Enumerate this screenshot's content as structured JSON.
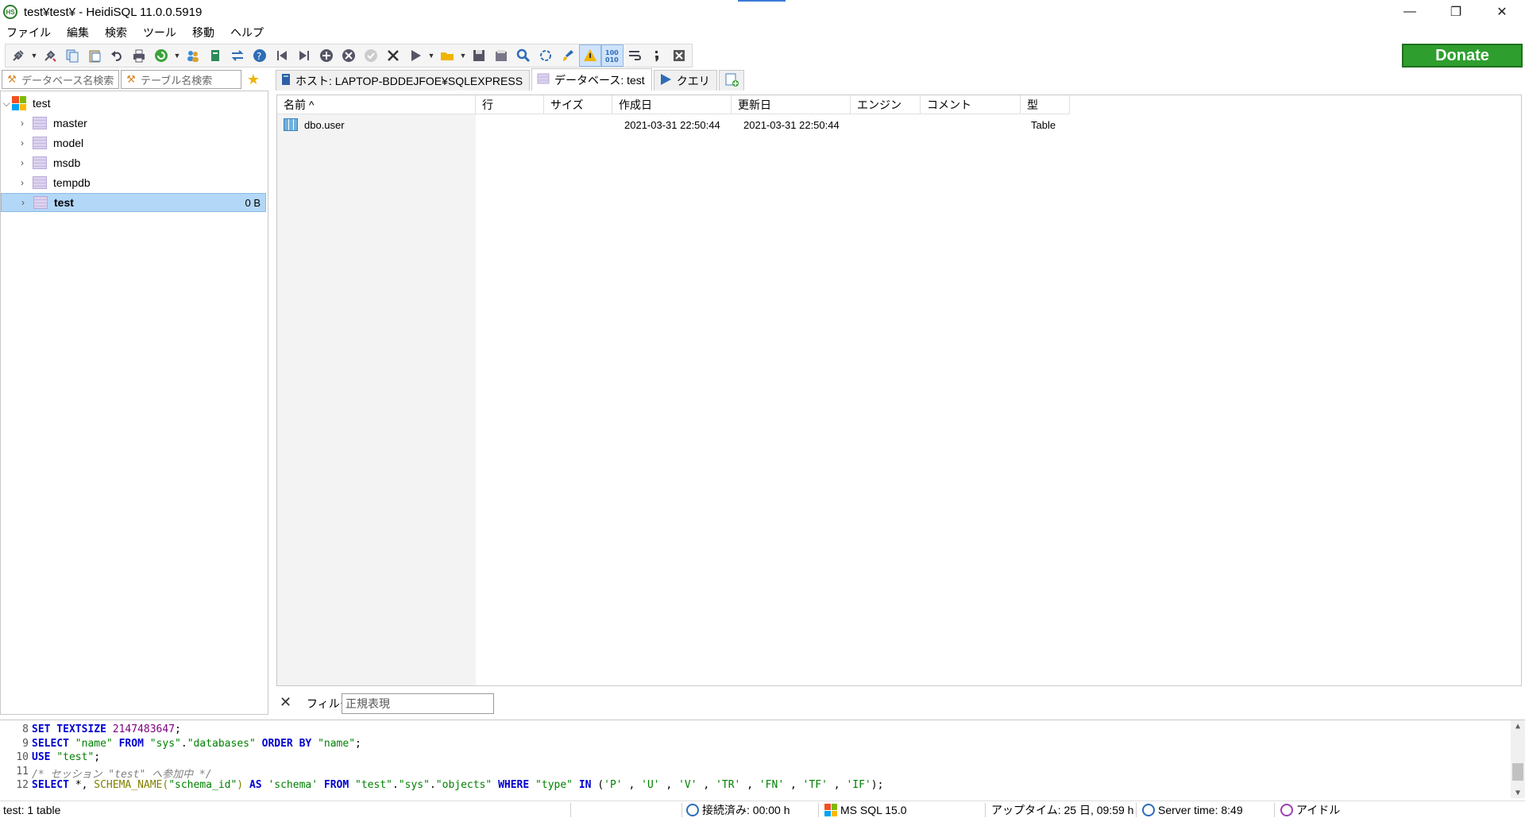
{
  "window": {
    "title": "test¥test¥ - HeidiSQL 11.0.0.5919",
    "app_icon_text": "HS",
    "minimize": "—",
    "restore": "❐",
    "close": "✕"
  },
  "menu": [
    "ファイル",
    "編集",
    "検索",
    "ツール",
    "移動",
    "ヘルプ"
  ],
  "donate_label": "Donate",
  "search": {
    "database_placeholder": "データベース名検索",
    "table_placeholder": "テーブル名検索"
  },
  "tabs": [
    {
      "label": "ホスト: LAPTOP-BDDEJFOE¥SQLEXPRESS",
      "icon": "server-icon"
    },
    {
      "label": "データベース: test",
      "icon": "database-icon"
    },
    {
      "label": "クエリ",
      "icon": "play-icon"
    }
  ],
  "tree": {
    "root": "test",
    "databases": [
      "master",
      "model",
      "msdb",
      "tempdb",
      "test"
    ],
    "selected": "test",
    "selected_size": "0 B"
  },
  "grid": {
    "columns": [
      "名前 ^",
      "行",
      "サイズ",
      "作成日",
      "更新日",
      "エンジン",
      "コメント",
      "型"
    ],
    "rows": [
      {
        "name": "dbo.user",
        "rows": "",
        "size": "",
        "created": "2021-03-31 22:50:44",
        "updated": "2021-03-31 22:50:44",
        "engine": "",
        "comment": "",
        "type": "Table"
      }
    ]
  },
  "filter": {
    "label": "フィルタ",
    "placeholder": "正規表現"
  },
  "sql_log": [
    {
      "ln": "8",
      "parts": [
        [
          "kw",
          "SET TEXTSIZE "
        ],
        [
          "num",
          "2147483647"
        ],
        [
          "",
          "; "
        ]
      ]
    },
    {
      "ln": "9",
      "parts": [
        [
          "kw",
          "SELECT "
        ],
        [
          "str",
          "\"name\""
        ],
        [
          "kw",
          " FROM "
        ],
        [
          "str",
          "\"sys\""
        ],
        [
          "",
          "."
        ],
        [
          "str",
          "\"databases\""
        ],
        [
          "kw",
          " ORDER BY "
        ],
        [
          "str",
          "\"name\""
        ],
        [
          "",
          ";"
        ]
      ]
    },
    {
      "ln": "10",
      "parts": [
        [
          "kw",
          "USE "
        ],
        [
          "str",
          "\"test\""
        ],
        [
          "",
          ";"
        ]
      ]
    },
    {
      "ln": "11",
      "parts": [
        [
          "cm",
          "/* セッション \"test\" へ参加中 */"
        ]
      ]
    },
    {
      "ln": "12",
      "parts": [
        [
          "kw",
          "SELECT "
        ],
        [
          "",
          "*, "
        ],
        [
          "fn",
          "SCHEMA_NAME("
        ],
        [
          "str",
          "\"schema_id\""
        ],
        [
          "fn",
          ")"
        ],
        [
          "kw",
          " AS "
        ],
        [
          "str",
          "'schema'"
        ],
        [
          "kw",
          " FROM "
        ],
        [
          "str",
          "\"test\""
        ],
        [
          "",
          "."
        ],
        [
          "str",
          "\"sys\""
        ],
        [
          "",
          "."
        ],
        [
          "str",
          "\"objects\""
        ],
        [
          "kw",
          " WHERE "
        ],
        [
          "str",
          "\"type\""
        ],
        [
          "kw",
          " IN "
        ],
        [
          "",
          "("
        ],
        [
          "str",
          "'P'"
        ],
        [
          "",
          " , "
        ],
        [
          "str",
          "'U'"
        ],
        [
          "",
          " , "
        ],
        [
          "str",
          "'V'"
        ],
        [
          "",
          " , "
        ],
        [
          "str",
          "'TR'"
        ],
        [
          "",
          " , "
        ],
        [
          "str",
          "'FN'"
        ],
        [
          "",
          " , "
        ],
        [
          "str",
          "'TF'"
        ],
        [
          "",
          " , "
        ],
        [
          "str",
          "'IF'"
        ],
        [
          "",
          ");"
        ]
      ]
    }
  ],
  "status": {
    "left": "test: 1 table",
    "connected": "接続済み: 00:00 h",
    "server": "MS SQL 15.0",
    "uptime": "アップタイム: 25 日, 09:59 h",
    "server_time": "Server time: 8:49",
    "idle": "アイドル"
  },
  "colors": {
    "accent_blue": "#3a7bd5",
    "selection": "#b3d7f7",
    "donate_green": "#2e9e2e",
    "sql_keyword": "#0000d0",
    "sql_string": "#008000"
  }
}
